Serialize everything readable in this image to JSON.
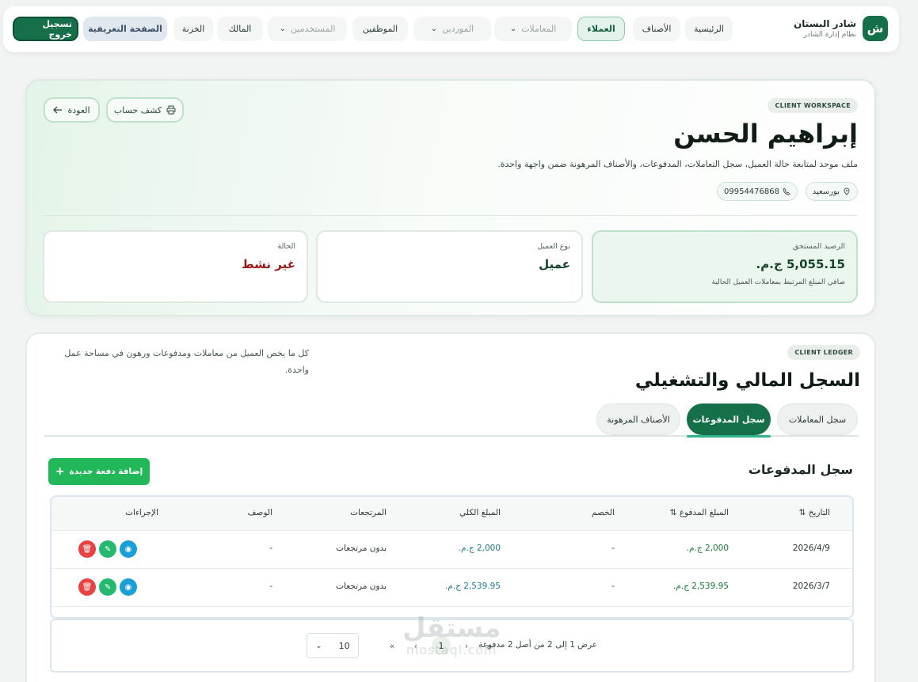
{
  "brand": {
    "logo_letter": "ش",
    "name": "شادر البستان",
    "subtitle": "نظام إدارة الشادر"
  },
  "nav": {
    "home": "الرئيسية",
    "items_cat": "الأصناف",
    "clients": "العملاء",
    "transactions": "المعاملات",
    "suppliers": "الموردين",
    "employees": "الموظفين",
    "users": "المستخدمين",
    "owner": "المالك",
    "treasury": "الخزنة",
    "intro_page": "الصفحة التعريفية",
    "logout": "تسجيل خروج"
  },
  "client": {
    "workspace_tag": "CLIENT WORKSPACE",
    "name": "إبراهيم الحسن",
    "description": "ملف موحد لمتابعة حالة العميل، سجل التعاملات، المدفوعات، والأصناف المرهونة ضمن واجهة واحدة.",
    "location": "بورسعيد",
    "phone": "09954476868",
    "statement_button": "كشف حساب",
    "back_button": "العودة",
    "balance_label": "الرصيد المستحق",
    "balance_value": "5,055.15 ج.م.",
    "balance_note": "صافي المبلغ المرتبط بمعاملات العميل الحالية",
    "type_label": "نوع العميل",
    "type_value": "عميل",
    "status_label": "الحالة",
    "status_value": "غير نشط"
  },
  "ledger": {
    "tag": "CLIENT LEDGER",
    "title": "السجل المالي والتشغيلي",
    "description": "كل ما يخص العميل من معاملات ومدفوعات ورهون في مساحة عمل واحدة.",
    "tabs": [
      "سجل المعاملات",
      "سجل المدفوعات",
      "الأصناف المرهونة"
    ],
    "section_title": "سجل المدفوعات",
    "add_button": "إضافة دفعة جديدة",
    "columns": [
      "التاريخ",
      "المبلغ المدفوع",
      "الخصم",
      "المبلغ الكلي",
      "المرتجعات",
      "الوصف",
      "الإجراءات"
    ],
    "rows": [
      {
        "date": "2026/4/9",
        "paid": "2,000 ج.م.",
        "discount": "-",
        "total": "2,000 ج.م.",
        "returns": "بدون مرتجعات",
        "desc": "-"
      },
      {
        "date": "2026/3/7",
        "paid": "2,539.95 ج.م.",
        "discount": "-",
        "total": "2,539.95 ج.م.",
        "returns": "بدون مرتجعات",
        "desc": "-"
      }
    ],
    "pager_text": "عرض 1 إلى 2 من أصل 2 مدفوعة",
    "current_page": "1",
    "page_size": "10"
  },
  "watermark": {
    "arabic": "مستقل",
    "latin": "mostaql.com"
  },
  "colors": {
    "brand_green": "#15704a",
    "accent_green": "#22b85a",
    "status_red": "#9b1a1a"
  }
}
